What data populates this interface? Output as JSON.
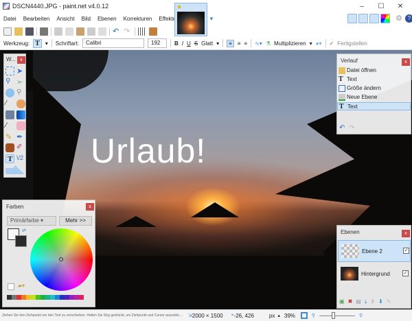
{
  "window": {
    "title": "DSCN4440.JPG - paint.net v4.0.12",
    "minimize": "–",
    "maximize": "☐",
    "close": "✕"
  },
  "menu": [
    "Datei",
    "Bearbeiten",
    "Ansicht",
    "Bild",
    "Ebenen",
    "Korrekturen",
    "Effekte"
  ],
  "options": {
    "tool_label": "Werkzeug:",
    "font_label": "Schriftart:",
    "font_value": "Calibri",
    "size_value": "192",
    "bold": "B",
    "italic": "I",
    "underline": "U",
    "strike": "S",
    "antialias": "Glatt",
    "blend_mode": "Multiplizieren",
    "finish": "Fertigstellen"
  },
  "canvas": {
    "text": "Urlaub!"
  },
  "tools_panel": {
    "title": "W..."
  },
  "colors_panel": {
    "title": "Farben",
    "select": "Primärfarbe",
    "more": "Mehr >>",
    "palette": [
      "#333333",
      "#777777",
      "#e03030",
      "#f07a20",
      "#f0c020",
      "#c0e020",
      "#50c020",
      "#20b040",
      "#20b090",
      "#20c0c0",
      "#2080e0",
      "#2030c0",
      "#5020c0",
      "#9020c0",
      "#c020a0",
      "#e02060"
    ]
  },
  "history_panel": {
    "title": "Verlauf",
    "items": [
      "Datei öffnen",
      "Text",
      "Größe ändern",
      "Neue Ebene",
      "Text"
    ]
  },
  "layers_panel": {
    "title": "Ebenen",
    "layers": [
      "Ebene 2",
      "Hintergrund"
    ]
  },
  "status": {
    "hint": "Ziehen Sie den Ziehpunkt um den Text zu verschieben. Halten Sie Strg gedrückt, um Ziehpunkt und Cursor auszublenden. Drücken Sie Strg, um de...",
    "image_size": "2000 × 1500",
    "cursor_pos": "-26, 426",
    "unit": "px",
    "zoom": "39%",
    "zoom_fraction": 0.39
  },
  "accent": "#cde3f7"
}
